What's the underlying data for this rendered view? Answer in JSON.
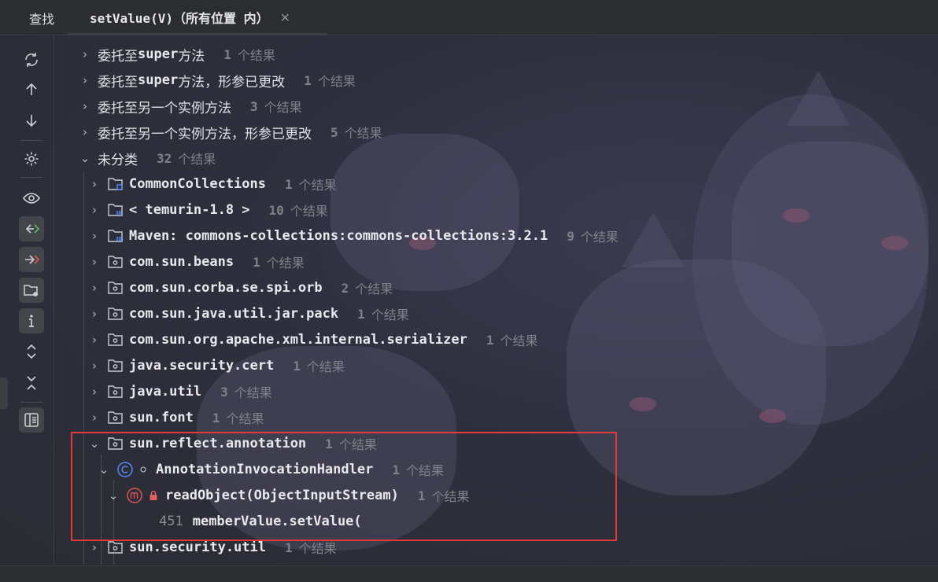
{
  "tabs": {
    "find_label": "查找",
    "active_label": "setValue(V)（所有位置 内）",
    "close_glyph": "✕"
  },
  "toolbar": {
    "icons": [
      "refresh-icon",
      "arrow-up-icon",
      "arrow-down-icon",
      "gear-icon",
      "eye-icon",
      "read-access-icon",
      "write-access-icon",
      "folder-settings-icon",
      "info-icon",
      "expand-all-icon",
      "collapse-all-icon",
      "preview-icon"
    ]
  },
  "tree": {
    "rows": [
      {
        "label_cn": "委托至 ",
        "label_code": "super",
        "label_cn2": " 方法",
        "count": "1",
        "count_label": "个结果"
      },
      {
        "label_cn": "委托至 ",
        "label_code": "super",
        "label_cn2": " 方法，形参已更改",
        "count": "1",
        "count_label": "个结果"
      },
      {
        "label_cn": "委托至另一个实例方法",
        "count": "3",
        "count_label": "个结果"
      },
      {
        "label_cn": "委托至另一个实例方法，形参已更改",
        "count": "5",
        "count_label": "个结果"
      },
      {
        "label_cn": "未分类",
        "count": "32",
        "count_label": "个结果"
      },
      {
        "label": "CommonCollections",
        "count": "1",
        "count_label": "个结果"
      },
      {
        "label": "< temurin-1.8 >",
        "count": "10",
        "count_label": "个结果"
      },
      {
        "label": "Maven: commons-collections:commons-collections:3.2.1",
        "count": "9",
        "count_label": "个结果"
      },
      {
        "label": "com.sun.beans",
        "count": "1",
        "count_label": "个结果"
      },
      {
        "label": "com.sun.corba.se.spi.orb",
        "count": "2",
        "count_label": "个结果"
      },
      {
        "label": "com.sun.java.util.jar.pack",
        "count": "1",
        "count_label": "个结果"
      },
      {
        "label": "com.sun.org.apache.xml.internal.serializer",
        "count": "1",
        "count_label": "个结果"
      },
      {
        "label": "java.security.cert",
        "count": "1",
        "count_label": "个结果"
      },
      {
        "label": "java.util",
        "count": "3",
        "count_label": "个结果"
      },
      {
        "label": "sun.font",
        "count": "1",
        "count_label": "个结果"
      },
      {
        "label": "sun.reflect.annotation",
        "count": "1",
        "count_label": "个结果"
      },
      {
        "label": "AnnotationInvocationHandler",
        "count": "1",
        "count_label": "个结果"
      },
      {
        "label": "readObject(ObjectInputStream)",
        "count": "1",
        "count_label": "个结果"
      },
      {
        "line_number": "451",
        "code": "memberValue.setValue("
      },
      {
        "label": "sun.security.util",
        "count": "1",
        "count_label": "个结果"
      }
    ]
  },
  "colors": {
    "background": "#2b2d30",
    "highlight_border": "#e03a3a",
    "class_icon": "#548af7",
    "method_icon": "#e05555",
    "count_text": "#7f8288"
  }
}
